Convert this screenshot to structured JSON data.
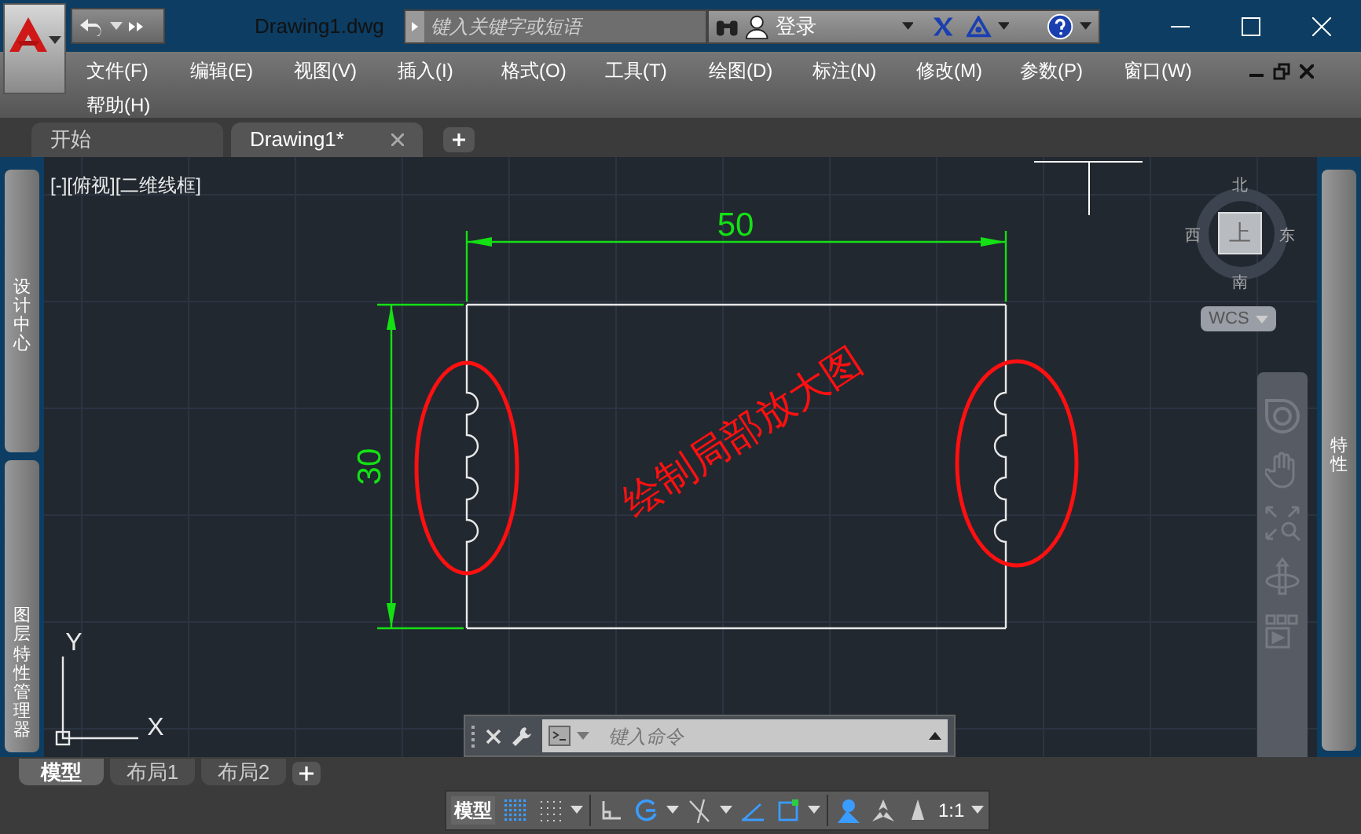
{
  "title_bar": {
    "filename": "Drawing1.dwg",
    "search": {
      "placeholder": "键入关键字或短语"
    },
    "sign_in": "登录"
  },
  "menu": [
    "文件(F)",
    "编辑(E)",
    "视图(V)",
    "插入(I)",
    "格式(O)",
    "工具(T)",
    "绘图(D)",
    "标注(N)",
    "修改(M)",
    "参数(P)",
    "窗口(W)",
    "帮助(H)"
  ],
  "doc_tabs": [
    {
      "label": "开始",
      "selected": false
    },
    {
      "label": "Drawing1*",
      "selected": true
    }
  ],
  "left_palettes": [
    "设计中心",
    "图层特性管理器"
  ],
  "right_palette": "特性",
  "viewport": {
    "label": "[-][俯视][二维线框]"
  },
  "drawing": {
    "dim_horizontal": "50",
    "dim_vertical": "30",
    "annotation": "绘制局部放大图",
    "ucs_x": "X",
    "ucs_y": "Y"
  },
  "viewcube": {
    "north": "北",
    "west": "西",
    "east": "东",
    "south": "南",
    "face": "上",
    "ucs": "WCS"
  },
  "command_line": {
    "placeholder": "键入命令"
  },
  "layout_tabs": [
    {
      "label": "模型",
      "selected": true
    },
    {
      "label": "布局1",
      "selected": false
    },
    {
      "label": "布局2",
      "selected": false
    }
  ],
  "status_bar": {
    "model": "模型",
    "scale": "1:1",
    "toggles": [
      {
        "kind": "grid",
        "on": true
      },
      {
        "kind": "snap",
        "on": false
      },
      {
        "kind": "ortho",
        "on": false
      },
      {
        "kind": "polar",
        "on": true
      },
      {
        "kind": "isodraft",
        "on": false
      },
      {
        "kind": "otrack",
        "on": true
      },
      {
        "kind": "osnap",
        "on": true
      },
      {
        "kind": "annovis",
        "on": true
      },
      {
        "kind": "autoscale",
        "on": false
      },
      {
        "kind": "annoscale",
        "on": false
      }
    ]
  }
}
